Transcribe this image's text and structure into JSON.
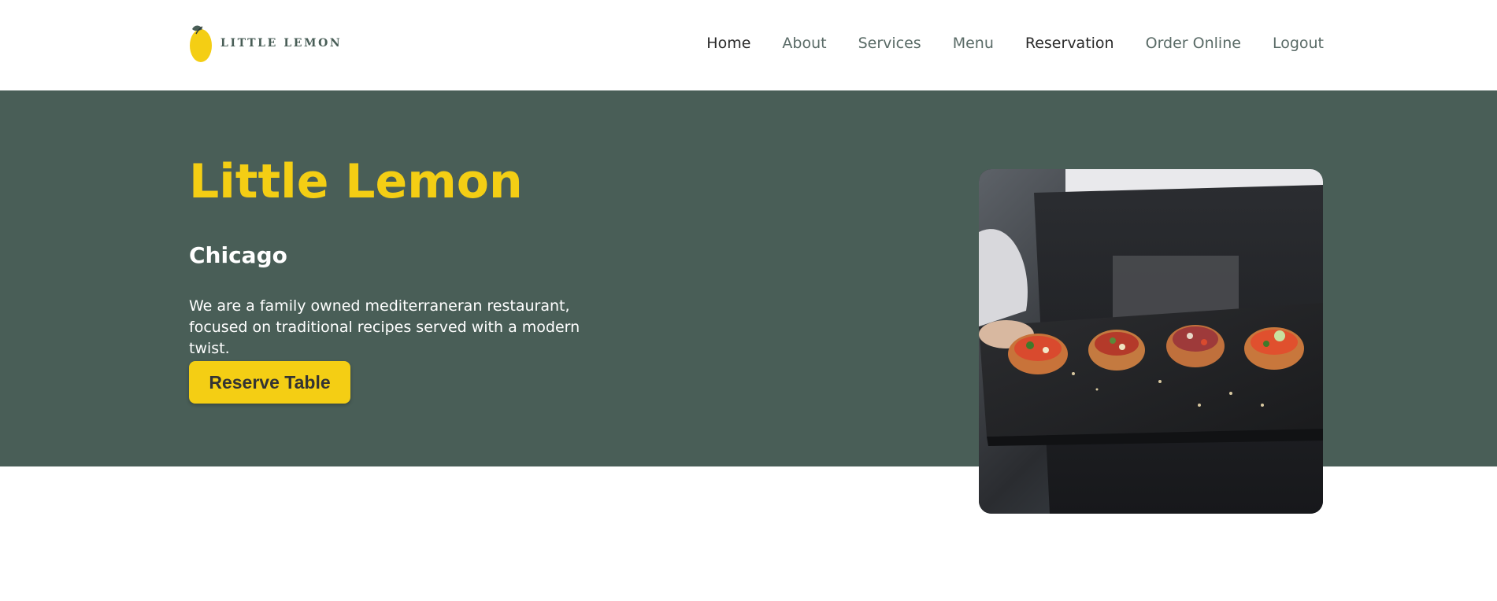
{
  "brand": {
    "name": "LITTLE LEMON",
    "accent_color": "#f4ce14",
    "primary_color": "#495e57"
  },
  "nav": {
    "items": [
      {
        "label": "Home"
      },
      {
        "label": "About"
      },
      {
        "label": "Services"
      },
      {
        "label": "Menu"
      },
      {
        "label": "Reservation"
      },
      {
        "label": "Order Online"
      },
      {
        "label": "Logout"
      }
    ]
  },
  "hero": {
    "title": "Little Lemon",
    "subtitle": "Chicago",
    "description": "We are a family owned mediterraneran restaurant, focused on traditional recipes served with a modern twist.",
    "cta_label": "Reserve Table",
    "image_icon": "food-photo"
  }
}
